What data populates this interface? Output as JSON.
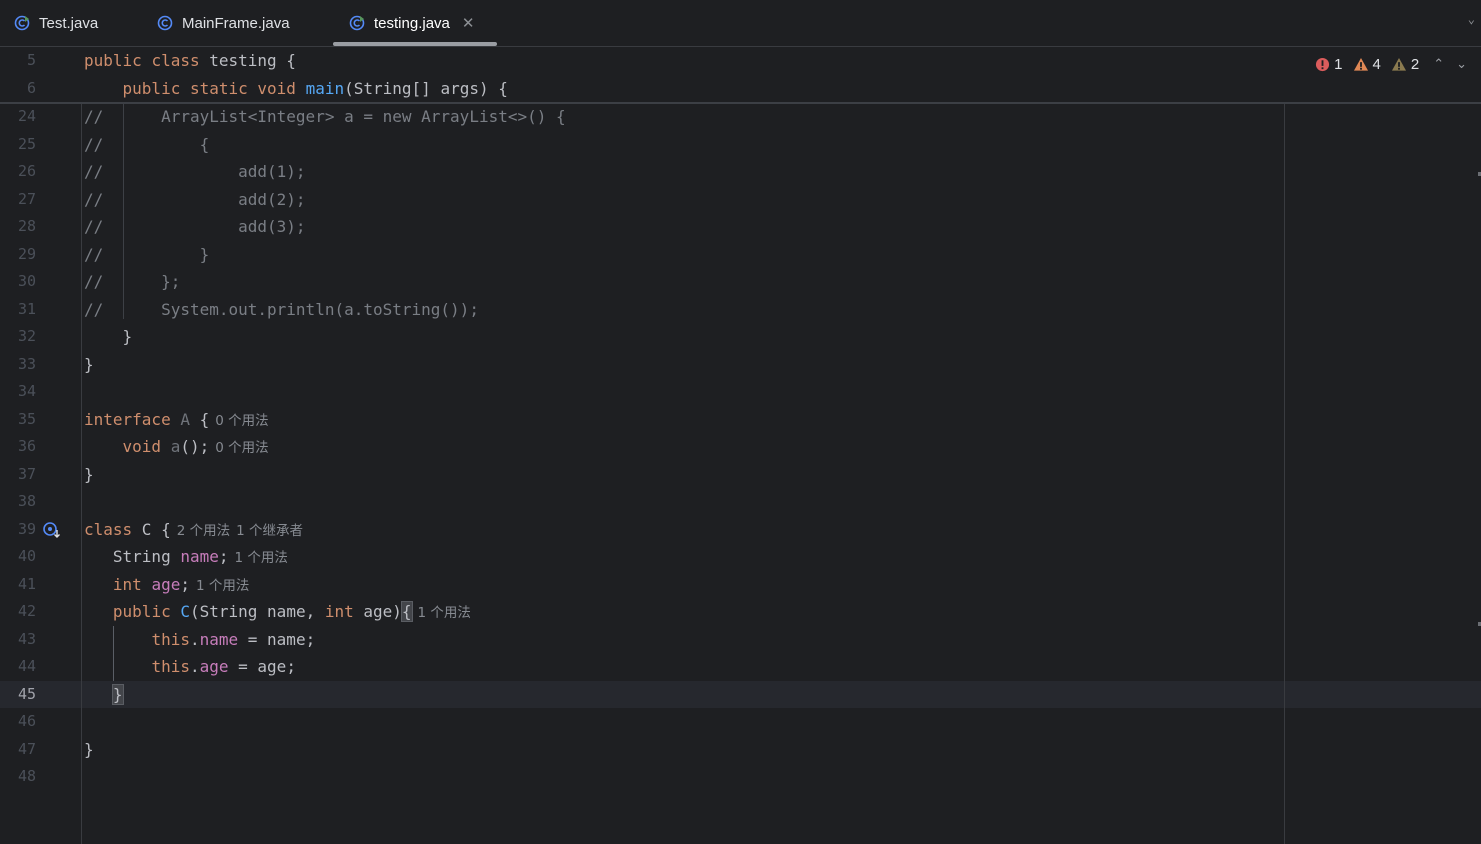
{
  "tabs": [
    {
      "label": "Test.java",
      "icon": "java-class-run-icon"
    },
    {
      "label": "MainFrame.java",
      "icon": "java-class-icon"
    },
    {
      "label": "testing.java",
      "icon": "java-class-run-icon",
      "active": true
    }
  ],
  "inspections": {
    "errors": "1",
    "warnings": "4",
    "weak_warnings": "2"
  },
  "colors": {
    "accent": "#56a8f5",
    "keyword": "#cf8e6d",
    "field": "#c77dbb",
    "error": "#db5c5c",
    "warning": "#e08855"
  },
  "sticky": [
    {
      "num": "5",
      "segs": [
        [
          "kw",
          "public "
        ],
        [
          "kw",
          "class "
        ],
        [
          "",
          "testing {"
        ]
      ]
    },
    {
      "num": "6",
      "segs": [
        [
          "",
          "    "
        ],
        [
          "kw",
          "public "
        ],
        [
          "kw",
          "static "
        ],
        [
          "kw",
          "void "
        ],
        [
          "fn",
          "main"
        ],
        [
          "",
          "(String[] args) {"
        ]
      ]
    }
  ],
  "lines": [
    {
      "num": "24",
      "segs": [
        [
          "cm",
          "//      ArrayList<Integer> a = new ArrayList<>() {"
        ]
      ]
    },
    {
      "num": "25",
      "segs": [
        [
          "cm",
          "//          {"
        ]
      ]
    },
    {
      "num": "26",
      "segs": [
        [
          "cm",
          "//              add(1);"
        ]
      ]
    },
    {
      "num": "27",
      "segs": [
        [
          "cm",
          "//              add(2);"
        ]
      ]
    },
    {
      "num": "28",
      "segs": [
        [
          "cm",
          "//              add(3);"
        ]
      ]
    },
    {
      "num": "29",
      "segs": [
        [
          "cm",
          "//          }"
        ]
      ]
    },
    {
      "num": "30",
      "segs": [
        [
          "cm",
          "//      };"
        ]
      ]
    },
    {
      "num": "31",
      "segs": [
        [
          "cm",
          "//      System.out.println(a.toString());"
        ]
      ]
    },
    {
      "num": "32",
      "segs": [
        [
          "",
          "    }"
        ]
      ]
    },
    {
      "num": "33",
      "segs": [
        [
          "",
          "}"
        ]
      ]
    },
    {
      "num": "34",
      "segs": []
    },
    {
      "num": "35",
      "segs": [
        [
          "kw",
          "interface "
        ],
        [
          "iface",
          "A "
        ],
        [
          "",
          "{"
        ],
        [
          "hint",
          "0 个用法"
        ]
      ]
    },
    {
      "num": "36",
      "segs": [
        [
          "",
          "    "
        ],
        [
          "kw",
          "void "
        ],
        [
          "iface",
          "a"
        ],
        [
          "",
          "();"
        ],
        [
          "hint",
          "0 个用法"
        ]
      ]
    },
    {
      "num": "37",
      "segs": [
        [
          "",
          "}"
        ]
      ]
    },
    {
      "num": "38",
      "segs": []
    },
    {
      "num": "39",
      "segs": [
        [
          "kw",
          "class "
        ],
        [
          "",
          "C {"
        ],
        [
          "hint",
          "2 个用法"
        ],
        [
          "hint",
          "1 个继承者"
        ]
      ],
      "gutter": "implemented-icon"
    },
    {
      "num": "40",
      "segs": [
        [
          "",
          "   String "
        ],
        [
          "fld",
          "name"
        ],
        [
          "",
          ";"
        ],
        [
          "hint",
          "1 个用法"
        ]
      ]
    },
    {
      "num": "41",
      "segs": [
        [
          "",
          "   "
        ],
        [
          "kw",
          "int "
        ],
        [
          "fld",
          "age"
        ],
        [
          "",
          ";"
        ],
        [
          "hint",
          "1 个用法"
        ]
      ]
    },
    {
      "num": "42",
      "segs": [
        [
          "",
          "   "
        ],
        [
          "kw",
          "public "
        ],
        [
          "fn",
          "C"
        ],
        [
          "",
          "(String name, "
        ],
        [
          "kw",
          "int "
        ],
        [
          "",
          "age)"
        ],
        [
          "brace",
          "{"
        ],
        [
          "hint",
          "1 个用法"
        ]
      ]
    },
    {
      "num": "43",
      "segs": [
        [
          "",
          "       "
        ],
        [
          "kw",
          "this"
        ],
        [
          "",
          "."
        ],
        [
          "fld",
          "name"
        ],
        [
          "",
          " = name;"
        ]
      ]
    },
    {
      "num": "44",
      "segs": [
        [
          "",
          "       "
        ],
        [
          "kw",
          "this"
        ],
        [
          "",
          "."
        ],
        [
          "fld",
          "age"
        ],
        [
          "",
          " = age;"
        ]
      ]
    },
    {
      "num": "45",
      "segs": [
        [
          "",
          "   "
        ],
        [
          "brace",
          "}"
        ]
      ],
      "current": true
    },
    {
      "num": "46",
      "segs": []
    },
    {
      "num": "47",
      "segs": [
        [
          "",
          "}"
        ]
      ]
    },
    {
      "num": "48",
      "segs": []
    }
  ]
}
